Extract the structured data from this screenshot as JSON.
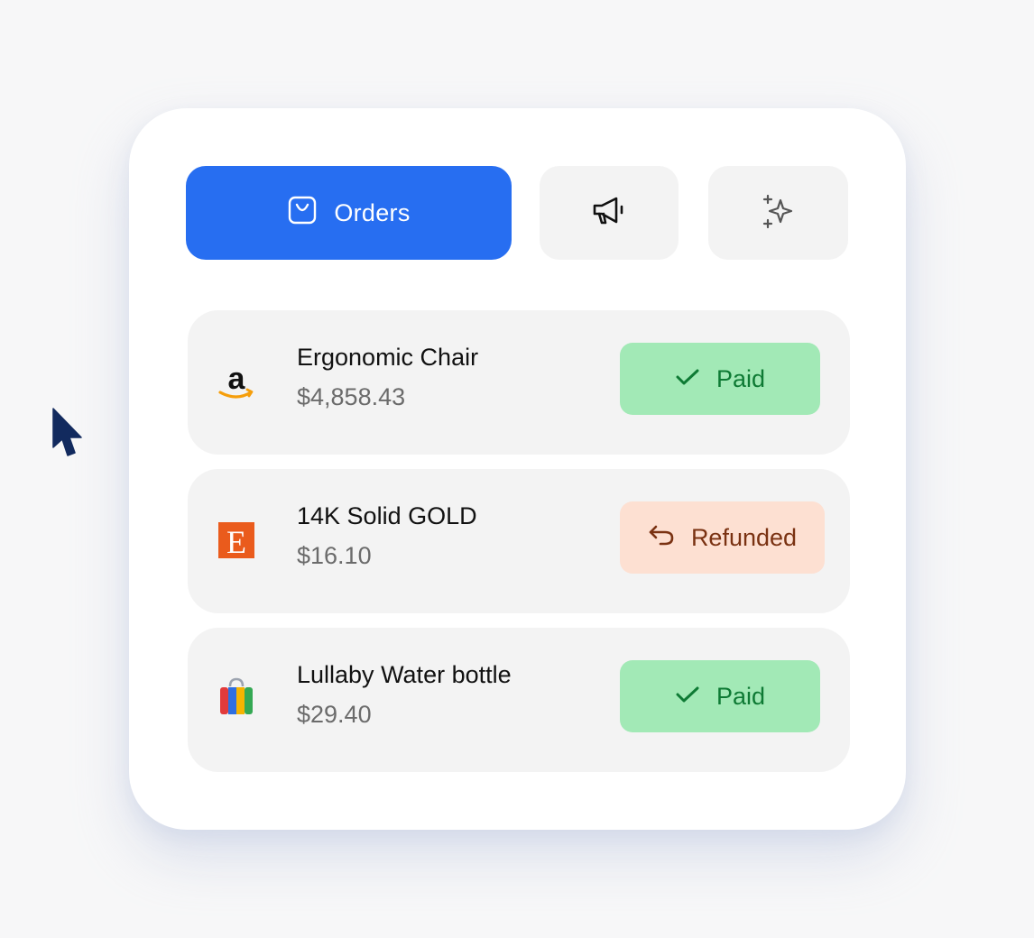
{
  "tabs": {
    "orders_label": "Orders"
  },
  "orders": [
    {
      "logo_icon": "amazon-logo-icon",
      "name": "Ergonomic Chair",
      "price": "$4,858.43",
      "status": "Paid"
    },
    {
      "logo_icon": "etsy-logo-icon",
      "logo_letter": "E",
      "name": "14K Solid GOLD",
      "price": "$16.10",
      "status": "Refunded"
    },
    {
      "logo_icon": "shopping-bag-logo-icon",
      "name": "Lullaby Water bottle",
      "price": "$29.40",
      "status": "Paid"
    }
  ],
  "colors": {
    "primary": "#276ef1",
    "paid_bg": "#a2e9b6",
    "paid_text": "#0e7a34",
    "refunded_bg": "#fde0d2",
    "refunded_text": "#7a3212",
    "cursor": "#122a5e"
  }
}
